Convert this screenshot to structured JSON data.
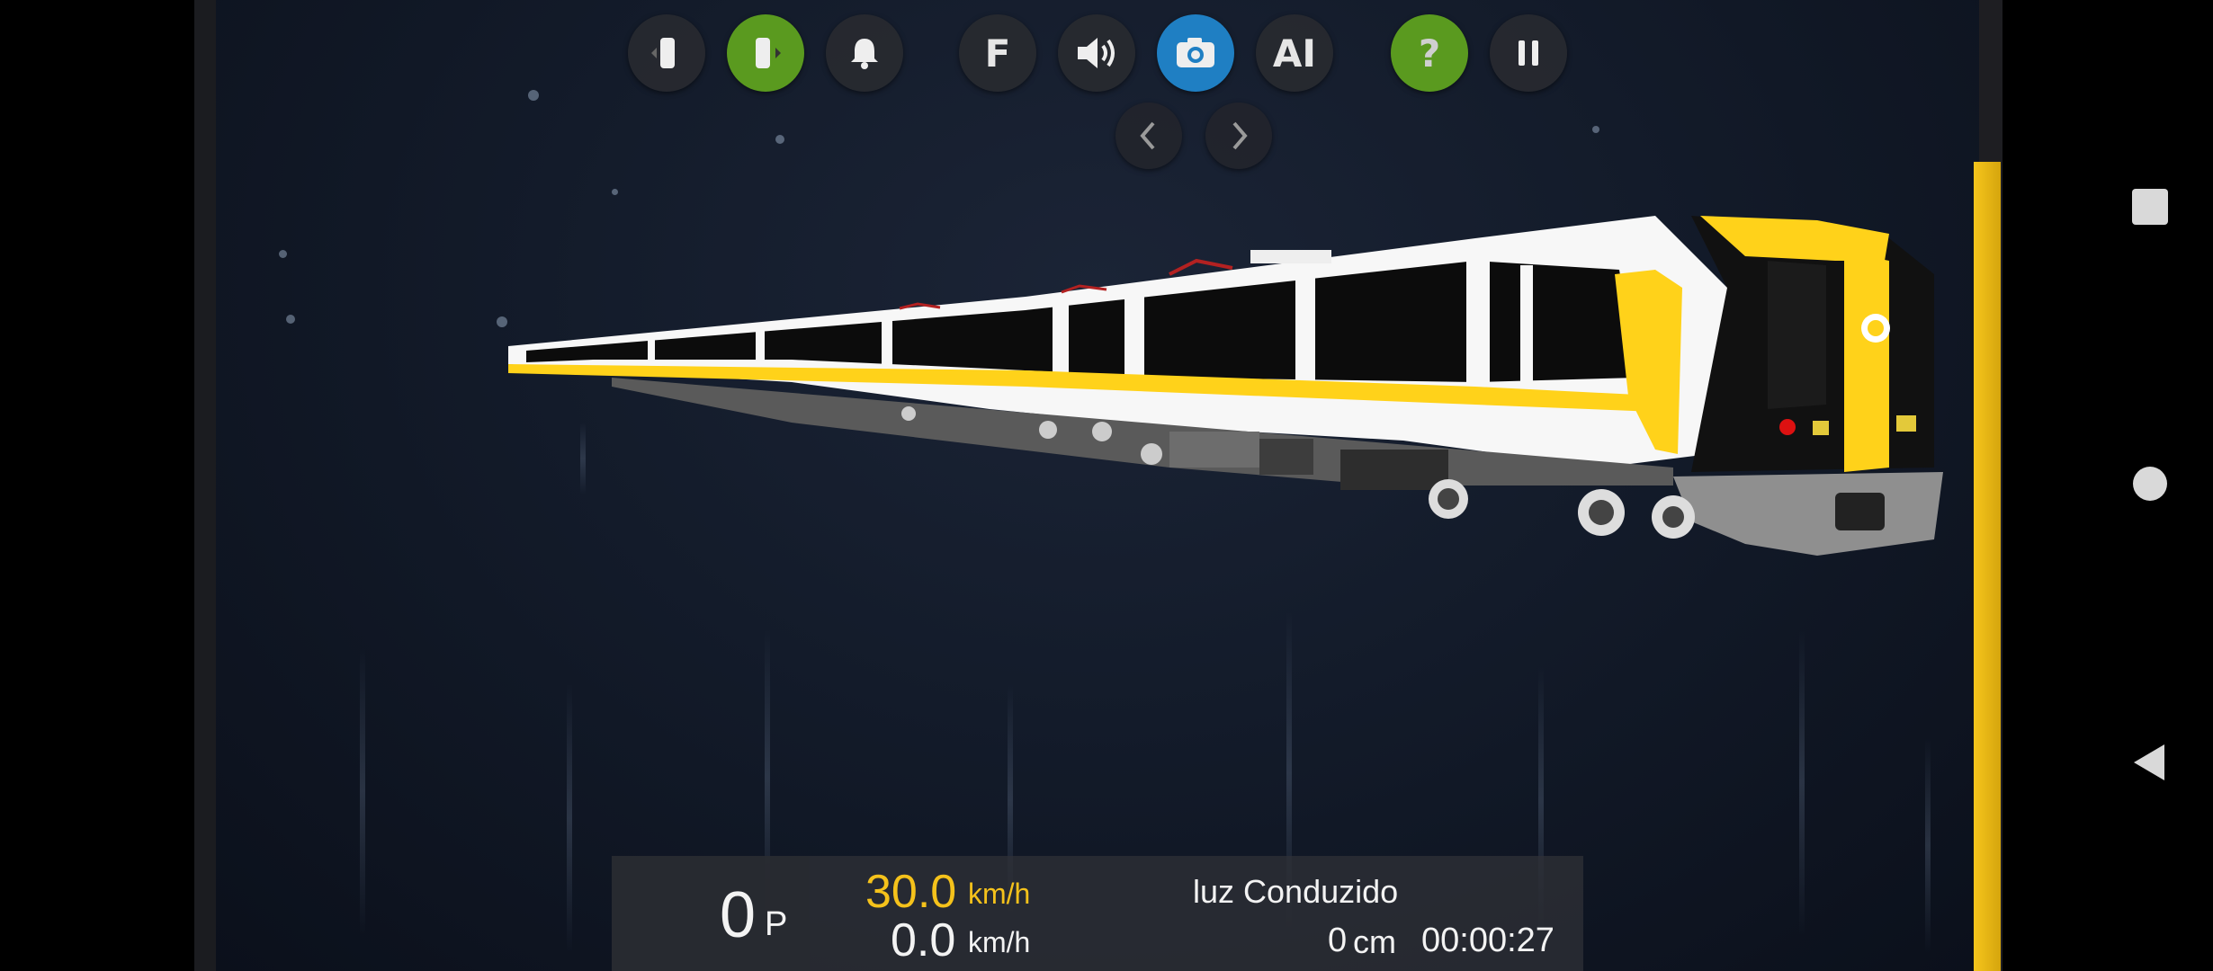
{
  "toolbar": {
    "buttons": [
      {
        "name": "door-left-button",
        "icon": "door-left-icon"
      },
      {
        "name": "door-right-button",
        "icon": "door-right-icon",
        "state": "active"
      },
      {
        "name": "bell-button",
        "icon": "bell-icon"
      },
      {
        "name": "function-button",
        "icon": "f-icon",
        "label": "F"
      },
      {
        "name": "sound-button",
        "icon": "speaker-icon"
      },
      {
        "name": "camera-button",
        "icon": "camera-icon",
        "state": "active"
      },
      {
        "name": "ai-button",
        "icon": "ai-icon",
        "label": "AI"
      },
      {
        "name": "help-button",
        "icon": "question-icon",
        "label": "?"
      },
      {
        "name": "pause-button",
        "icon": "pause-icon"
      }
    ],
    "camera_prev_icon": "chevron-left-icon",
    "camera_next_icon": "chevron-right-icon"
  },
  "hud": {
    "points_value": "0",
    "points_unit": "P",
    "speed_limit_value": "30.0",
    "speed_limit_unit": "km/h",
    "speed_value": "0.0",
    "speed_unit": "km/h",
    "status_text": "luz Conduzido",
    "distance_value": "0",
    "distance_unit": "cm",
    "timer": "00:00:27"
  },
  "colors": {
    "accent_green": "#5a9a1f",
    "accent_blue": "#1f7fc3",
    "speed_limit_color": "#f5c21b",
    "side_bar_yellow": "#f6c51c",
    "train_white": "#ffffff",
    "train_yellow": "#ffd21a"
  },
  "system_nav": {
    "recents_icon": "square-icon",
    "home_icon": "circle-icon",
    "back_icon": "triangle-back-icon"
  }
}
